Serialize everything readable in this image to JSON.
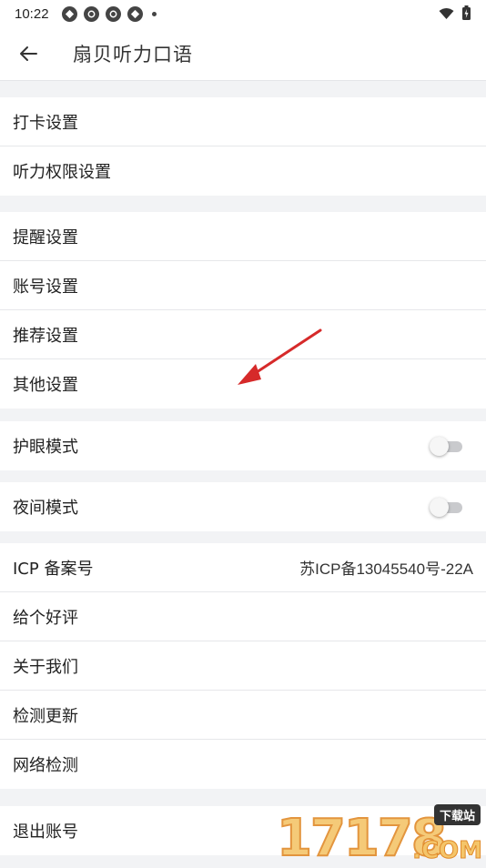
{
  "status_bar": {
    "time": "10:22"
  },
  "app_bar": {
    "title": "扇贝听力口语"
  },
  "groups": [
    {
      "items": [
        {
          "label": "打卡设置"
        },
        {
          "label": "听力权限设置"
        }
      ]
    },
    {
      "items": [
        {
          "label": "提醒设置"
        },
        {
          "label": "账号设置"
        },
        {
          "label": "推荐设置"
        },
        {
          "label": "其他设置"
        }
      ]
    },
    {
      "items": [
        {
          "label": "护眼模式",
          "toggle": "off"
        }
      ]
    },
    {
      "items": [
        {
          "label": "夜间模式",
          "toggle": "off"
        }
      ]
    },
    {
      "items": [
        {
          "label": "ICP 备案号",
          "value": "苏ICP备13045540号-22A"
        },
        {
          "label": "给个好评"
        },
        {
          "label": "关于我们"
        },
        {
          "label": "检测更新"
        },
        {
          "label": "网络检测"
        }
      ]
    },
    {
      "items": [
        {
          "label": "退出账号"
        }
      ]
    }
  ],
  "watermark": {
    "digits": "17178",
    "badge": "下载站",
    "suffix": ".COM"
  },
  "colors": {
    "background": "#f2f3f5",
    "arrow": "#d62a2a",
    "toggle_track": "#c9cacd"
  }
}
